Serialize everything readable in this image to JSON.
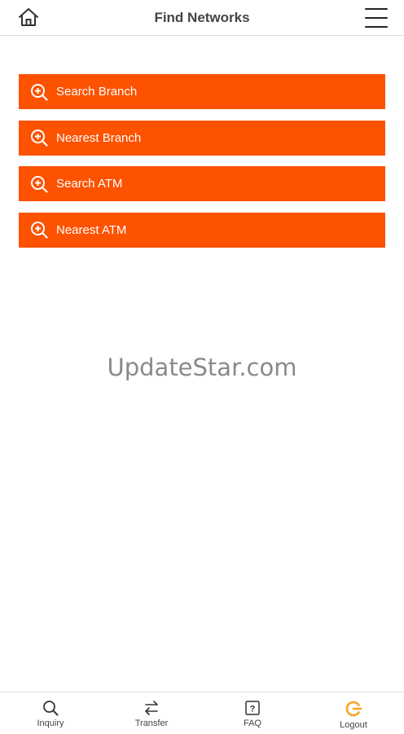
{
  "header": {
    "title": "Find Networks",
    "home_icon": "home-icon",
    "menu_icon": "hamburger-menu-icon"
  },
  "actions": [
    {
      "label": "Search Branch",
      "icon": "zoom-plus-icon"
    },
    {
      "label": "Nearest Branch",
      "icon": "zoom-plus-icon"
    },
    {
      "label": "Search ATM",
      "icon": "zoom-plus-icon"
    },
    {
      "label": "Nearest ATM",
      "icon": "zoom-plus-icon"
    }
  ],
  "watermark": "UpdateStar.com",
  "bottom_nav": [
    {
      "label": "Inquiry",
      "icon": "search-icon"
    },
    {
      "label": "Transfer",
      "icon": "transfer-arrows-icon"
    },
    {
      "label": "FAQ",
      "icon": "question-box-icon"
    },
    {
      "label": "Logout",
      "icon": "logout-icon"
    }
  ],
  "colors": {
    "accent": "#fd5200",
    "logout_accent": "#f5a623",
    "text_dark": "#444444",
    "divider": "#dcdcdc"
  }
}
